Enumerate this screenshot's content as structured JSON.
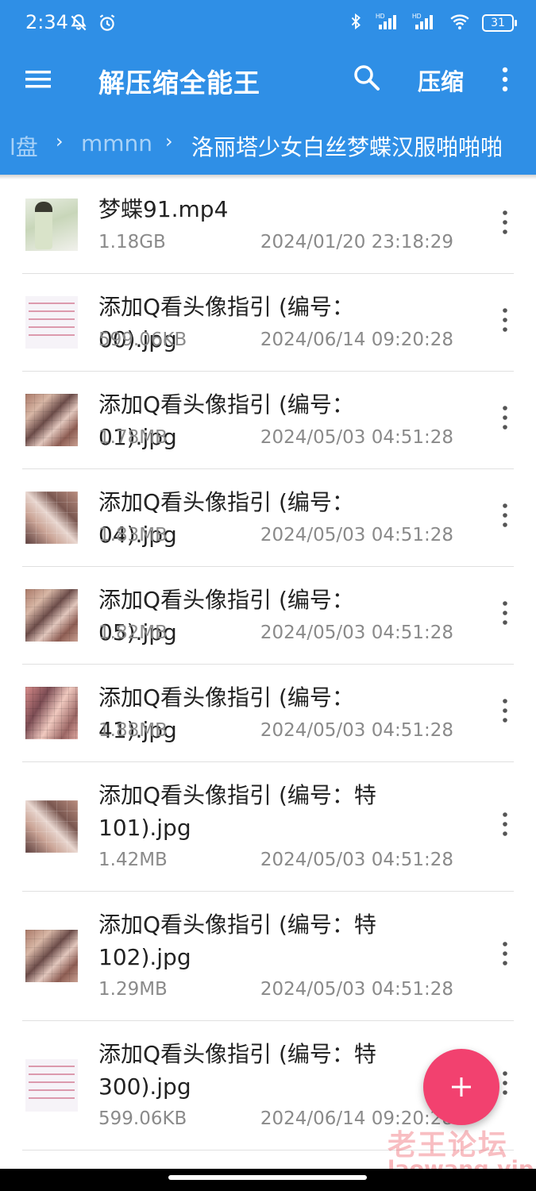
{
  "status_bar": {
    "time": "2:34",
    "battery": "31",
    "icons": [
      "bell-off-icon",
      "alarm-icon",
      "bluetooth-icon",
      "hd-signal-icon",
      "hd-signal-icon",
      "wifi-icon",
      "battery-icon"
    ]
  },
  "app_bar": {
    "title": "解压缩全能王",
    "compress_label": "压缩",
    "icons": [
      "menu-icon",
      "search-icon",
      "more-vert-icon"
    ]
  },
  "breadcrumb": {
    "items": [
      "l盘",
      "mmnn",
      "洛丽塔少女白丝梦蝶汉服啪啪啪"
    ],
    "separator": "›"
  },
  "files": [
    {
      "name": "梦蝶91.mp4",
      "size": "1.18GB",
      "date": "2024/01/20 23:18:29",
      "thumb": "video"
    },
    {
      "name": "添加Q看头像指引 (编号：00).jpg",
      "size": "599.06KB",
      "date": "2024/06/14 09:20:28",
      "thumb": "doc"
    },
    {
      "name": "添加Q看头像指引 (编号：01).jpg",
      "size": "1.78MB",
      "date": "2024/05/03 04:51:28",
      "thumb": "collage"
    },
    {
      "name": "添加Q看头像指引 (编号：04).jpg",
      "size": "1.83MB",
      "date": "2024/05/03 04:51:28",
      "thumb": "collage"
    },
    {
      "name": "添加Q看头像指引 (编号：05).jpg",
      "size": "1.82MB",
      "date": "2024/05/03 04:51:28",
      "thumb": "collage"
    },
    {
      "name": "添加Q看头像指引 (编号：41).jpg",
      "size": "1.88MB",
      "date": "2024/05/03 04:51:28",
      "thumb": "collage"
    },
    {
      "name_line1": "添加Q看头像指引 (编号：特",
      "name_line2": "101).jpg",
      "size": "1.42MB",
      "date": "2024/05/03 04:51:28",
      "thumb": "collage"
    },
    {
      "name_line1": "添加Q看头像指引 (编号：特",
      "name_line2": "102).jpg",
      "size": "1.29MB",
      "date": "2024/05/03 04:51:28",
      "thumb": "collage"
    },
    {
      "name_line1": "添加Q看头像指引 (编号：特",
      "name_line2": "300).jpg",
      "size": "599.06KB",
      "date": "2024/06/14 09:20:28",
      "thumb": "doc"
    }
  ],
  "fab": {
    "icon": "plus-icon"
  },
  "watermark": {
    "text": "老王论坛",
    "url": "laowang.vip"
  },
  "colors": {
    "primary": "#2f8fe6",
    "fab": "#f2416f",
    "text_primary": "#222222",
    "text_secondary": "#8a8a8a",
    "breadcrumb_dim": "#a9d2f7"
  }
}
